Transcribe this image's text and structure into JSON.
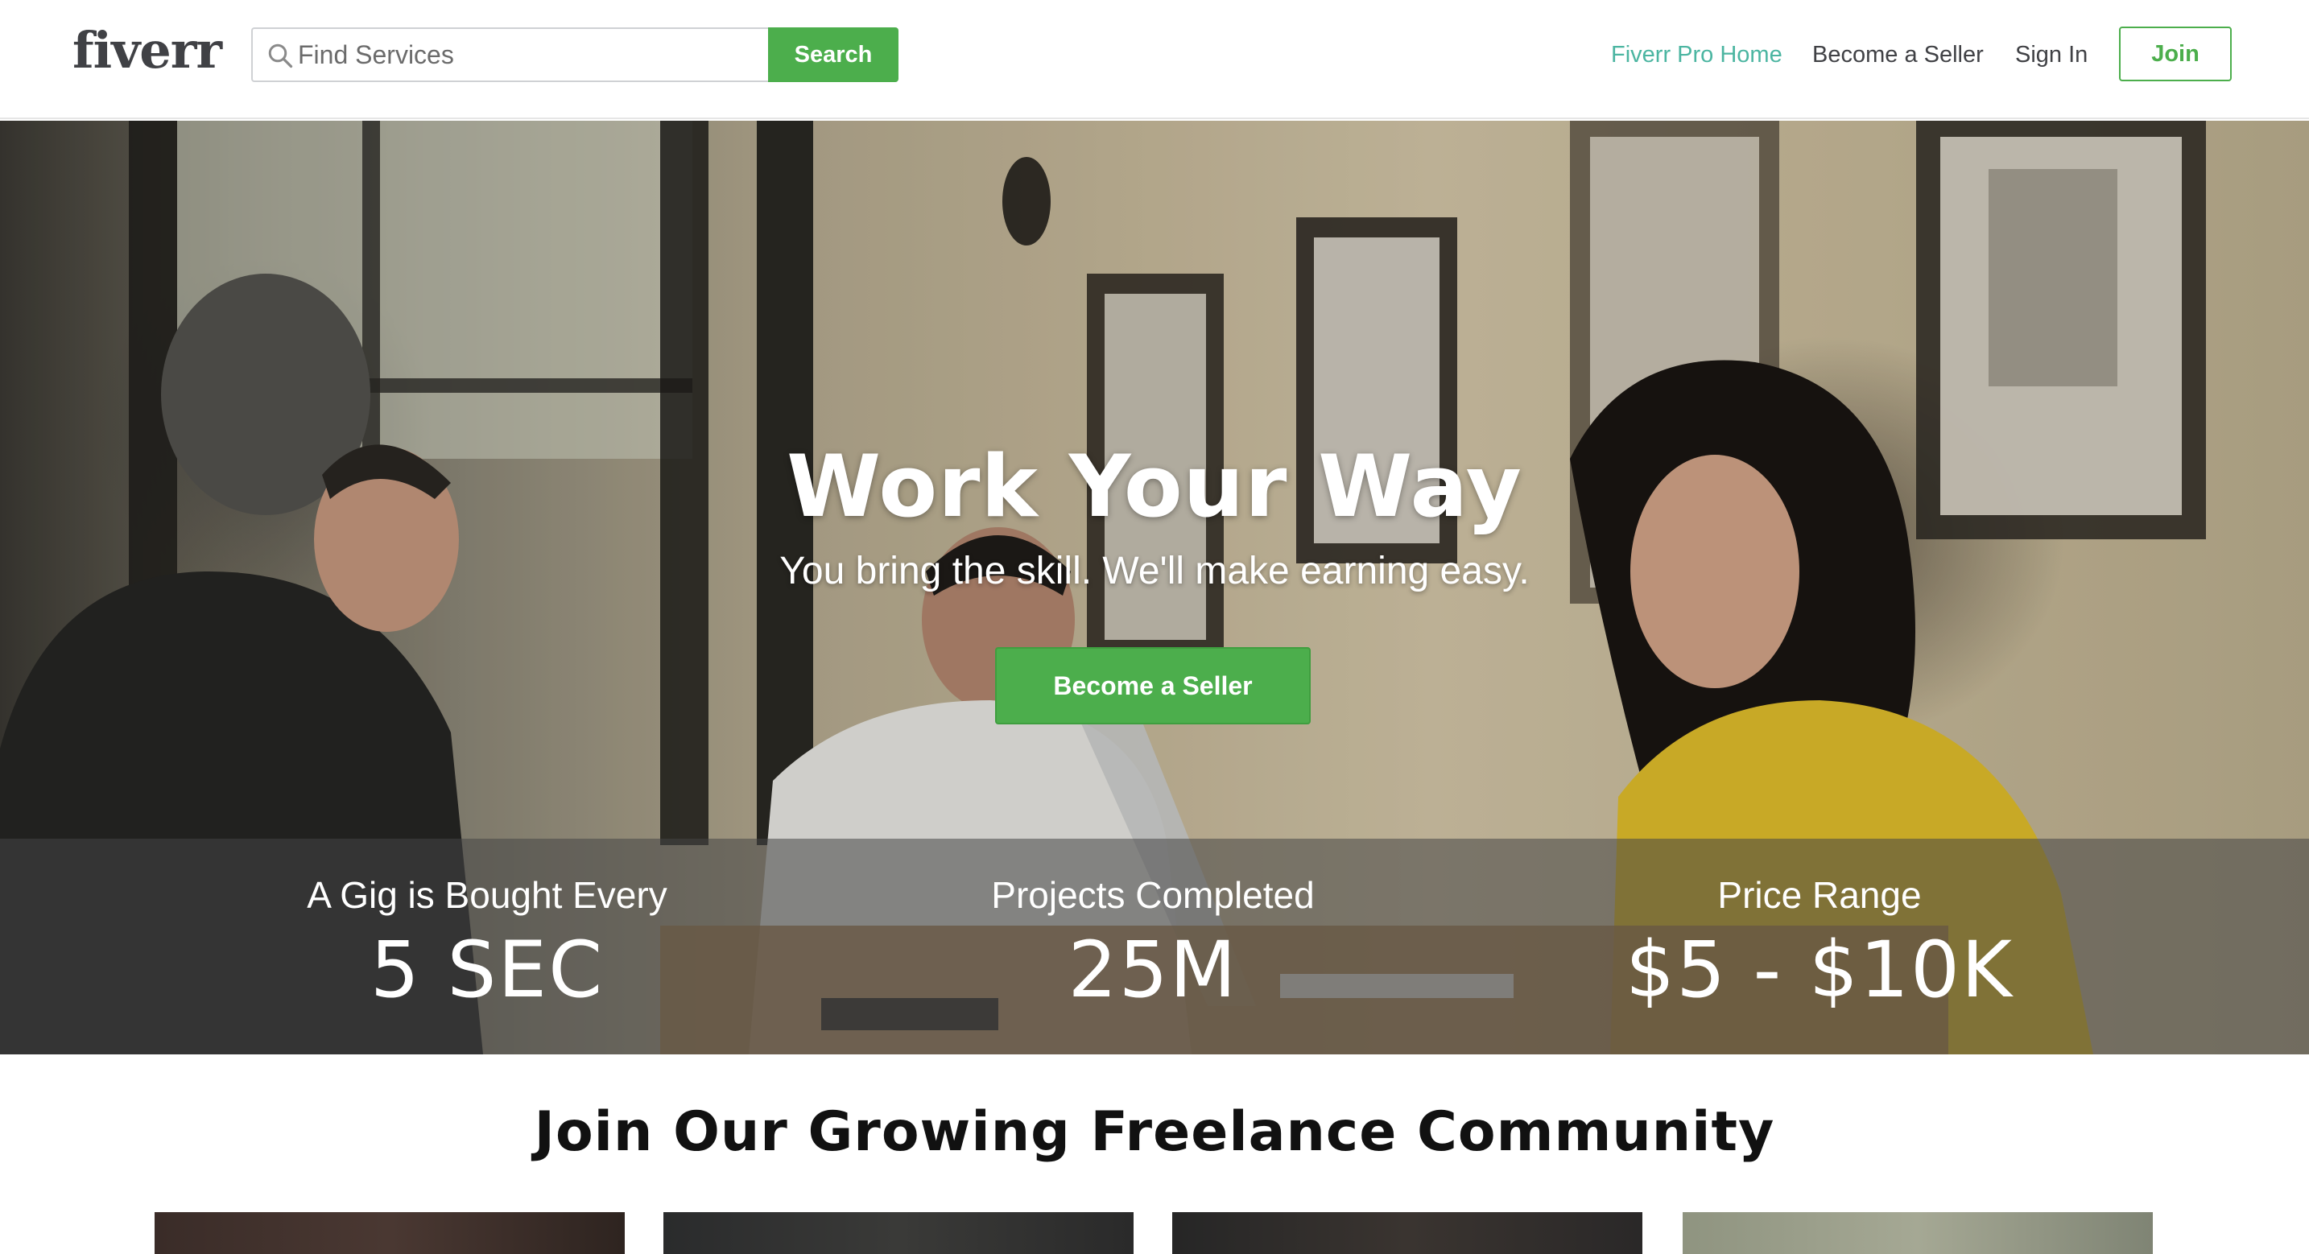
{
  "header": {
    "logo": "fiverr",
    "search": {
      "placeholder": "Find Services",
      "value": "",
      "button_label": "Search"
    },
    "nav": {
      "pro_home": "Fiverr Pro Home",
      "become_seller": "Become a Seller",
      "sign_in": "Sign In",
      "join": "Join"
    }
  },
  "hero": {
    "title": "Work Your Way",
    "subtitle": "You bring the skill. We'll make earning easy.",
    "cta_label": "Become a Seller",
    "stats": [
      {
        "label": "A Gig is Bought Every",
        "value": "5 SEC"
      },
      {
        "label": "Projects Completed",
        "value": "25M"
      },
      {
        "label": "Price Range",
        "value": "$5 - $10K"
      }
    ]
  },
  "community": {
    "title": "Join Our Growing Freelance Community"
  },
  "colors": {
    "brand_green": "#4cae4c",
    "pro_teal": "#4bb5a1",
    "logo_gray": "#404145",
    "nav_text": "#404145"
  },
  "icons": {
    "search": "search-icon"
  }
}
